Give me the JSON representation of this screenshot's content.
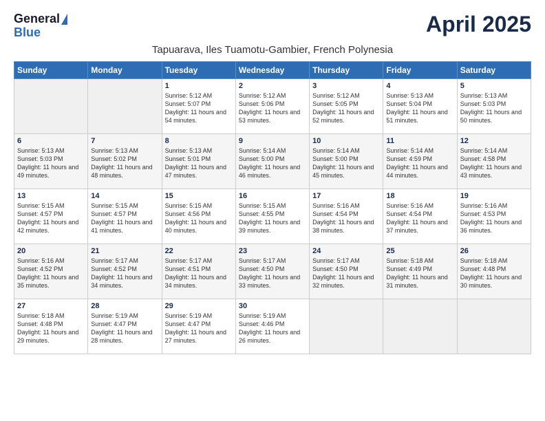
{
  "header": {
    "logo_general": "General",
    "logo_blue": "Blue",
    "month_title": "April 2025",
    "location": "Tapuarava, Iles Tuamotu-Gambier, French Polynesia"
  },
  "weekdays": [
    "Sunday",
    "Monday",
    "Tuesday",
    "Wednesday",
    "Thursday",
    "Friday",
    "Saturday"
  ],
  "weeks": [
    [
      {
        "day": "",
        "info": ""
      },
      {
        "day": "",
        "info": ""
      },
      {
        "day": "1",
        "info": "Sunrise: 5:12 AM\nSunset: 5:07 PM\nDaylight: 11 hours and 54 minutes."
      },
      {
        "day": "2",
        "info": "Sunrise: 5:12 AM\nSunset: 5:06 PM\nDaylight: 11 hours and 53 minutes."
      },
      {
        "day": "3",
        "info": "Sunrise: 5:12 AM\nSunset: 5:05 PM\nDaylight: 11 hours and 52 minutes."
      },
      {
        "day": "4",
        "info": "Sunrise: 5:13 AM\nSunset: 5:04 PM\nDaylight: 11 hours and 51 minutes."
      },
      {
        "day": "5",
        "info": "Sunrise: 5:13 AM\nSunset: 5:03 PM\nDaylight: 11 hours and 50 minutes."
      }
    ],
    [
      {
        "day": "6",
        "info": "Sunrise: 5:13 AM\nSunset: 5:03 PM\nDaylight: 11 hours and 49 minutes."
      },
      {
        "day": "7",
        "info": "Sunrise: 5:13 AM\nSunset: 5:02 PM\nDaylight: 11 hours and 48 minutes."
      },
      {
        "day": "8",
        "info": "Sunrise: 5:13 AM\nSunset: 5:01 PM\nDaylight: 11 hours and 47 minutes."
      },
      {
        "day": "9",
        "info": "Sunrise: 5:14 AM\nSunset: 5:00 PM\nDaylight: 11 hours and 46 minutes."
      },
      {
        "day": "10",
        "info": "Sunrise: 5:14 AM\nSunset: 5:00 PM\nDaylight: 11 hours and 45 minutes."
      },
      {
        "day": "11",
        "info": "Sunrise: 5:14 AM\nSunset: 4:59 PM\nDaylight: 11 hours and 44 minutes."
      },
      {
        "day": "12",
        "info": "Sunrise: 5:14 AM\nSunset: 4:58 PM\nDaylight: 11 hours and 43 minutes."
      }
    ],
    [
      {
        "day": "13",
        "info": "Sunrise: 5:15 AM\nSunset: 4:57 PM\nDaylight: 11 hours and 42 minutes."
      },
      {
        "day": "14",
        "info": "Sunrise: 5:15 AM\nSunset: 4:57 PM\nDaylight: 11 hours and 41 minutes."
      },
      {
        "day": "15",
        "info": "Sunrise: 5:15 AM\nSunset: 4:56 PM\nDaylight: 11 hours and 40 minutes."
      },
      {
        "day": "16",
        "info": "Sunrise: 5:15 AM\nSunset: 4:55 PM\nDaylight: 11 hours and 39 minutes."
      },
      {
        "day": "17",
        "info": "Sunrise: 5:16 AM\nSunset: 4:54 PM\nDaylight: 11 hours and 38 minutes."
      },
      {
        "day": "18",
        "info": "Sunrise: 5:16 AM\nSunset: 4:54 PM\nDaylight: 11 hours and 37 minutes."
      },
      {
        "day": "19",
        "info": "Sunrise: 5:16 AM\nSunset: 4:53 PM\nDaylight: 11 hours and 36 minutes."
      }
    ],
    [
      {
        "day": "20",
        "info": "Sunrise: 5:16 AM\nSunset: 4:52 PM\nDaylight: 11 hours and 35 minutes."
      },
      {
        "day": "21",
        "info": "Sunrise: 5:17 AM\nSunset: 4:52 PM\nDaylight: 11 hours and 34 minutes."
      },
      {
        "day": "22",
        "info": "Sunrise: 5:17 AM\nSunset: 4:51 PM\nDaylight: 11 hours and 34 minutes."
      },
      {
        "day": "23",
        "info": "Sunrise: 5:17 AM\nSunset: 4:50 PM\nDaylight: 11 hours and 33 minutes."
      },
      {
        "day": "24",
        "info": "Sunrise: 5:17 AM\nSunset: 4:50 PM\nDaylight: 11 hours and 32 minutes."
      },
      {
        "day": "25",
        "info": "Sunrise: 5:18 AM\nSunset: 4:49 PM\nDaylight: 11 hours and 31 minutes."
      },
      {
        "day": "26",
        "info": "Sunrise: 5:18 AM\nSunset: 4:48 PM\nDaylight: 11 hours and 30 minutes."
      }
    ],
    [
      {
        "day": "27",
        "info": "Sunrise: 5:18 AM\nSunset: 4:48 PM\nDaylight: 11 hours and 29 minutes."
      },
      {
        "day": "28",
        "info": "Sunrise: 5:19 AM\nSunset: 4:47 PM\nDaylight: 11 hours and 28 minutes."
      },
      {
        "day": "29",
        "info": "Sunrise: 5:19 AM\nSunset: 4:47 PM\nDaylight: 11 hours and 27 minutes."
      },
      {
        "day": "30",
        "info": "Sunrise: 5:19 AM\nSunset: 4:46 PM\nDaylight: 11 hours and 26 minutes."
      },
      {
        "day": "",
        "info": ""
      },
      {
        "day": "",
        "info": ""
      },
      {
        "day": "",
        "info": ""
      }
    ]
  ]
}
